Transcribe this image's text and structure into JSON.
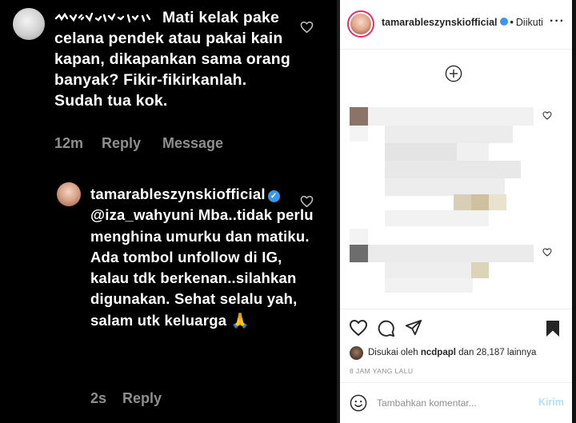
{
  "left": {
    "comment1": {
      "username_obscured": true,
      "text": "Mati kelak pake celana pendek atau pakai kain kapan, dikapankan sama orang banyak? Fikir-fikirkanlah. Sudah tua kok.",
      "time": "12m",
      "reply_label": "Reply",
      "message_label": "Message"
    },
    "comment2": {
      "username": "tamarableszynskiofficial",
      "mention": "@iza_wahyuni",
      "text": "Mba..tidak perlu menghina umurku dan matiku. Ada tombol unfollow di IG, kalau tdk berkenan..silahkan digunakan. Sehat selalu yah, salam utk keluarga 🙏",
      "time": "2s",
      "reply_label": "Reply"
    }
  },
  "right": {
    "header": {
      "username": "tamarableszynskiofficial",
      "follow_status": "Diikuti",
      "more_icon": "more-horizontal-icon"
    },
    "add_icon": "plus-circle-icon",
    "likes": {
      "prefix": "Disukai oleh",
      "user": "ncdpapl",
      "suffix": "dan 28,187 lainnya"
    },
    "time": "8 JAM YANG LALU",
    "comment_placeholder": "Tambahkan komentar...",
    "send_label": "Kirim"
  },
  "colors": {
    "verified": "#3897f0",
    "send_disabled": "#b2dffc",
    "muted": "#8e8e8e"
  }
}
